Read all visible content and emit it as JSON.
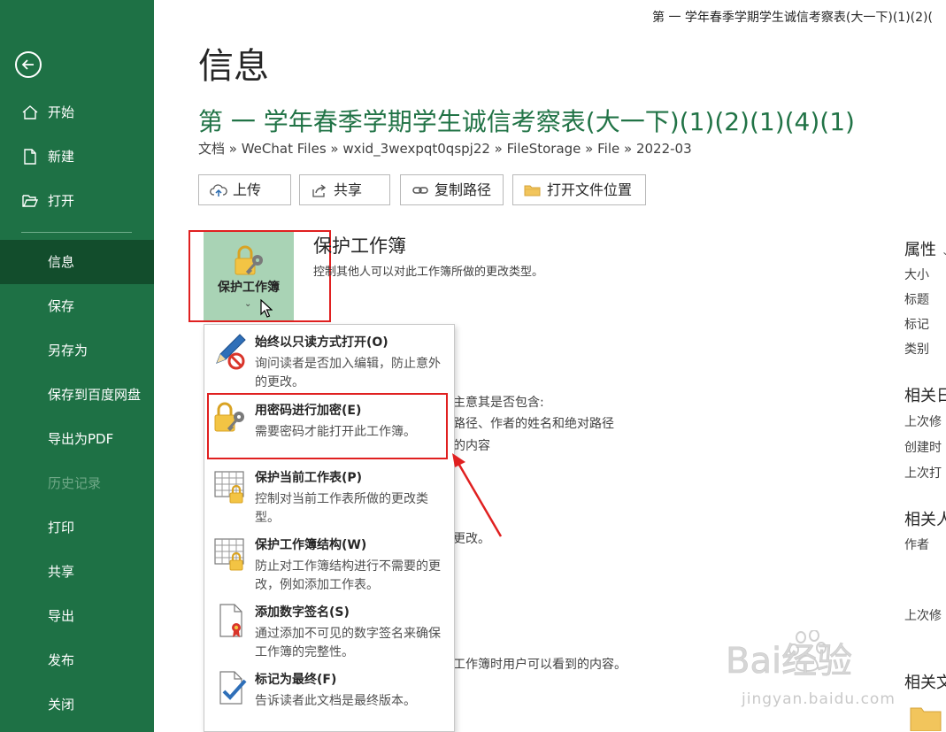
{
  "window_title": "第 一 学年春季学期学生诚信考察表(大一下)(1)(2)(",
  "sidebar": {
    "items": [
      {
        "label": "开始",
        "icon": "home-icon"
      },
      {
        "label": "新建",
        "icon": "new-document-icon"
      },
      {
        "label": "打开",
        "icon": "open-folder-icon"
      },
      {
        "label": "信息",
        "active": true
      },
      {
        "label": "保存"
      },
      {
        "label": "另存为"
      },
      {
        "label": "保存到百度网盘"
      },
      {
        "label": "导出为PDF"
      },
      {
        "label": "历史记录",
        "disabled": true
      },
      {
        "label": "打印"
      },
      {
        "label": "共享"
      },
      {
        "label": "导出"
      },
      {
        "label": "发布"
      },
      {
        "label": "关闭"
      }
    ]
  },
  "main": {
    "page_title": "信息",
    "doc_title": "第 一 学年春季学期学生诚信考察表(大一下)(1)(2)(1)(4)(1)",
    "breadcrumb": "文档 » WeChat Files » wxid_3wexpqt0qspj22 » FileStorage » File » 2022-03",
    "actions": [
      "上传",
      "共享",
      "复制路径",
      "打开文件位置"
    ],
    "protect": {
      "tile_label": "保护工作簿",
      "heading": "保护工作簿",
      "description": "控制其他人可以对此工作簿所做的更改类型。"
    },
    "background_text": {
      "line1": "主意其是否包含:",
      "line2": "路径、作者的姓名和绝对路径",
      "line3": "的内容",
      "line4": "更改。",
      "line5": "工作簿时用户可以看到的内容。"
    }
  },
  "menu": {
    "items": [
      {
        "title": "始终以只读方式打开(O)",
        "desc": "询问读者是否加入编辑，防止意外的更改。",
        "icon": "pencil-no-edit-icon"
      },
      {
        "title": "用密码进行加密(E)",
        "desc": "需要密码才能打开此工作簿。",
        "icon": "lock-key-icon"
      },
      {
        "title": "保护当前工作表(P)",
        "desc": "控制对当前工作表所做的更改类型。",
        "icon": "sheet-lock-icon"
      },
      {
        "title": "保护工作簿结构(W)",
        "desc": "防止对工作簿结构进行不需要的更改，例如添加工作表。",
        "icon": "workbook-structure-lock-icon"
      },
      {
        "title": "添加数字签名(S)",
        "desc": "通过添加不可见的数字签名来确保工作簿的完整性。",
        "icon": "digital-signature-icon"
      },
      {
        "title": "标记为最终(F)",
        "desc": "告诉读者此文档是最终版本。",
        "icon": "mark-final-icon"
      }
    ]
  },
  "properties": {
    "heading": "属性",
    "fields": [
      "大小",
      "标题",
      "标记",
      "类别"
    ],
    "dates_heading": "相关日",
    "dates": [
      "上次修",
      "创建时",
      "上次打"
    ],
    "people_heading": "相关人",
    "people": [
      "作者"
    ],
    "modified_by": "上次修",
    "docs_heading": "相关文"
  },
  "watermark": {
    "logo_text": "Bai经验",
    "url": "jingyan.baidu.com"
  },
  "colors": {
    "sidebar": "#1e7145",
    "sidebar_active": "#124d2c",
    "accent_green": "#217346",
    "tile": "#a9d3b5",
    "highlight_red": "#e02020"
  }
}
